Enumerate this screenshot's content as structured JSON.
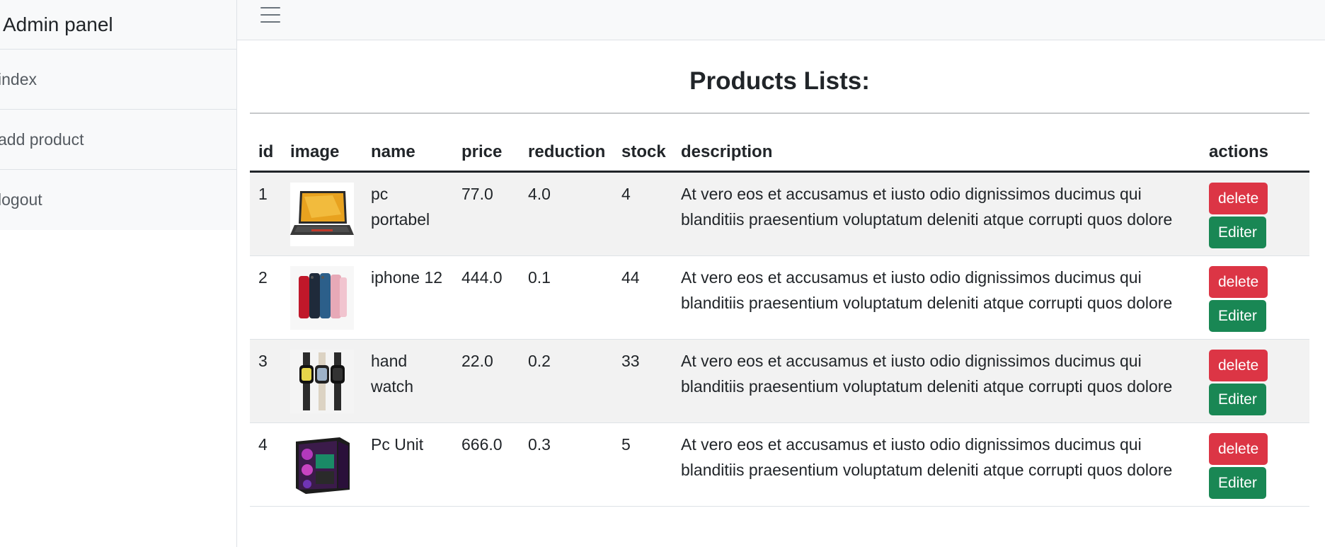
{
  "sidebar": {
    "heading": "Admin panel",
    "items": [
      {
        "label": "index"
      },
      {
        "label": "add product"
      },
      {
        "label": "logout"
      }
    ]
  },
  "main": {
    "title": "Products Lists:",
    "columns": [
      "id",
      "image",
      "name",
      "price",
      "reduction",
      "stock",
      "description",
      "actions"
    ],
    "rows": [
      {
        "id": "1",
        "name": "pc portabel",
        "price": "77.0",
        "reduction": "4.0",
        "stock": "4",
        "description": "At vero eos et accusamus et iusto odio dignissimos ducimus qui blanditiis praesentium voluptatum deleniti atque corrupti quos dolore",
        "delete_label": "delete",
        "edit_label": "Editer"
      },
      {
        "id": "2",
        "name": "iphone 12",
        "price": "444.0",
        "reduction": "0.1",
        "stock": "44",
        "description": "At vero eos et accusamus et iusto odio dignissimos ducimus qui blanditiis praesentium voluptatum deleniti atque corrupti quos dolore",
        "delete_label": "delete",
        "edit_label": "Editer"
      },
      {
        "id": "3",
        "name": "hand watch",
        "price": "22.0",
        "reduction": "0.2",
        "stock": "33",
        "description": "At vero eos et accusamus et iusto odio dignissimos ducimus qui blanditiis praesentium voluptatum deleniti atque corrupti quos dolore",
        "delete_label": "delete",
        "edit_label": "Editer"
      },
      {
        "id": "4",
        "name": "Pc Unit",
        "price": "666.0",
        "reduction": "0.3",
        "stock": "5",
        "description": "At vero eos et accusamus et iusto odio dignissimos ducimus qui blanditiis praesentium voluptatum deleniti atque corrupti quos dolore",
        "delete_label": "delete",
        "edit_label": "Editer"
      }
    ]
  },
  "colors": {
    "delete": "#dc3545",
    "edit": "#198754",
    "striped_row": "#f2f2f2"
  }
}
